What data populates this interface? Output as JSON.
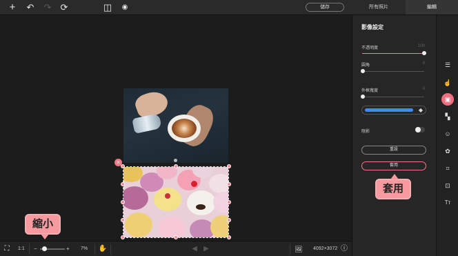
{
  "toolbar": {
    "add_icon": "+",
    "undo_icon": "↶",
    "redo_icon": "↷",
    "refresh_icon": "⟳",
    "compare_icon": "◫",
    "preview_icon": "◉",
    "save_label": "儲存",
    "tabs": [
      "所有照片",
      "編輯"
    ],
    "active_tab": "編輯"
  },
  "canvas": {
    "close_icon": "×"
  },
  "callouts": {
    "zoom": "縮小",
    "apply": "套用"
  },
  "bottom": {
    "fit_icon": "⛶",
    "ratio_label": "1:1",
    "zoom_minus": "−",
    "zoom_plus": "+",
    "zoom_level": "7%",
    "zoom_fraction": 0.07,
    "hand_icon": "✋",
    "prev_icon": "◀",
    "next_icon": "▶",
    "image_icon": "🖼",
    "dimensions": "4092×3072",
    "info_icon": "ⓘ"
  },
  "panel": {
    "title": "影像設定",
    "opacity_label": "不透明度",
    "opacity_value": "100",
    "rounded_label": "圓角",
    "rounded_value": "0",
    "border_width_label": "外框寬度",
    "border_width_value": "0",
    "border_color": "#3f8bf0",
    "bucket_icon": "◆",
    "shadow_label": "陰影",
    "shadow_on": false,
    "reset_label": "重設",
    "apply_label": "套用"
  },
  "rail": {
    "icons": [
      "adjust-icon",
      "touch-icon",
      "image-settings-icon",
      "pattern-icon",
      "sticker-icon",
      "blend-icon",
      "crop-icon",
      "resize-icon",
      "text-icon"
    ],
    "glyphs": [
      "☰",
      "☝",
      "▣",
      "▚",
      "☺",
      "✿",
      "⌗",
      "⊡",
      "Tт"
    ]
  },
  "colors": {
    "accent": "#ef6f80",
    "callout": "#f79aa0"
  }
}
